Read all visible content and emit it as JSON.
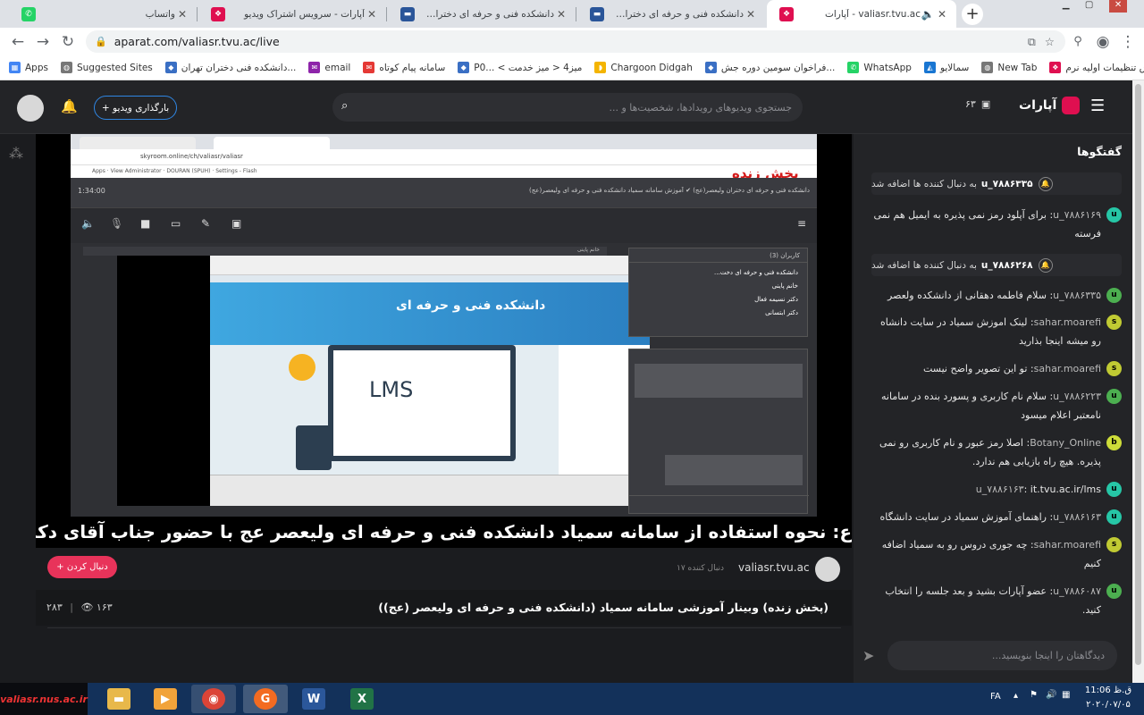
{
  "tabs": [
    {
      "title": "واتساب",
      "favicon": "whatsapp-icon",
      "color": "#25d366",
      "active": false
    },
    {
      "title": "آپارات - سرویس اشتراک ویدیو",
      "favicon": "aparat-icon",
      "color": "#df0f50",
      "active": false
    },
    {
      "title": "دانشکده فنی و حرفه ای دختران ولیعصر(ع)",
      "favicon": "skyroom-icon",
      "color": "#2a5599",
      "active": false
    },
    {
      "title": "دانشکده فنی و حرفه ای دختران ولیعصر(ع)",
      "favicon": "skyroom-icon",
      "color": "#2a5599",
      "active": false
    },
    {
      "title": "valiasr.tvu.ac - آپارات",
      "favicon": "aparat-icon",
      "color": "#df0f50",
      "active": true
    }
  ],
  "url": "aparat.com/valiasr.tvu.ac/live",
  "bookmarks": [
    {
      "label": "Apps",
      "icon": "apps-grid-icon",
      "color": "#4285f4"
    },
    {
      "label": "Suggested Sites",
      "icon": "globe-icon",
      "color": "#555"
    },
    {
      "label": "دانشکده فنی دختران تهران...",
      "icon": "site-icon",
      "color": "#3a6fc4"
    },
    {
      "label": "email",
      "icon": "email-icon",
      "color": "#8e24aa"
    },
    {
      "label": "سامانه پیام کوتاه",
      "icon": "sms-icon",
      "color": "#e53935"
    },
    {
      "label": "P0... < میز4 < میز خدمت",
      "icon": "site-icon",
      "color": "#3a6fc4"
    },
    {
      "label": "Chargoon Didgah",
      "icon": "chargoon-icon",
      "color": "#f4b400"
    },
    {
      "label": "فراخوان سومین دوره جش...",
      "icon": "site-icon",
      "color": "#3a6fc4"
    },
    {
      "label": "WhatsApp",
      "icon": "whatsapp-icon",
      "color": "#25d366"
    },
    {
      "label": "سمالایو",
      "icon": "samalive-icon",
      "color": "#1976d2"
    },
    {
      "label": "New Tab",
      "icon": "globe-icon",
      "color": "#555"
    },
    {
      "label": "آموزش تنظیمات اولیه نرم...",
      "icon": "aparat-icon",
      "color": "#df0f50"
    }
  ],
  "header": {
    "search_placeholder": "جستجوی ویدیوهای رویدادها، شخصیت‌ها و ...",
    "upload_label": "+ بارگذاری ویدیو",
    "count": "۶۳",
    "logo": "آپارات"
  },
  "player": {
    "live_label": "پخش زنده",
    "inner_url": "skyroom.online/ch/valiasr/valiasr",
    "session_title": "دانشکده فنی و حرفه ای دختران ولیعصر(عج) ✔ آموزش سامانه سمیاد دانشکده فنی و حرفه ای ولیعصر(عج)",
    "timer": "1:34:00",
    "share_title": "خانم پاینی",
    "users_title": "کاربران (3)",
    "users": [
      "دانشکده فنی و حرفه ای دخت...",
      "خانم پاینی",
      "دکتر نسیمه فعال",
      "دکتر ابتسانی"
    ],
    "lms_text": "LMS",
    "college_text": "دانشکده فنی و حرفه ای",
    "marquee": "ع: نحوه استفاده از سامانه سمیاد      دانشکده فنی و حرفه ای ولیعصر عج      با حضور جناب آقای دکتر"
  },
  "channel": {
    "name": "valiasr.tvu.ac",
    "followers": "۱۷ دنبال کننده",
    "follow_label": "+ دنبال کردن"
  },
  "video": {
    "title": "(پخش زنده) وبینار آموزشی سامانه سمیاد (دانشکده فنی و حرفه ای ولیعصر (عج))",
    "views": "۱۶۳",
    "likes": "۲۸۳"
  },
  "chat": {
    "heading": "گفتگوها",
    "input_placeholder": "دیدگاهتان را اینجا بنویسید...",
    "messages": [
      {
        "type": "join",
        "user": "u_۷۸۸۶۳۳۵",
        "text": "به دنبال کننده ها اضافه شد"
      },
      {
        "type": "msg",
        "user": "u_۷۸۸۶۱۶۹",
        "avatar": "u",
        "color": "#26c6a6",
        "text": "برای آپلود رمز نمی پذیره به ایمیل هم نمی فرسته"
      },
      {
        "type": "join",
        "user": "u_۷۸۸۶۲۶۸",
        "text": "به دنبال کننده ها اضافه شد"
      },
      {
        "type": "msg",
        "user": "u_۷۸۸۶۳۳۵",
        "avatar": "u",
        "color": "#4caf50",
        "text": "سلام فاطمه دهقانی از دانشکده ولعصر"
      },
      {
        "type": "msg",
        "user": "sahar.moarefi",
        "avatar": "s",
        "color": "#c0ca33",
        "text": "لینک اموزش سمیاد در سایت دانشاه رو میشه اینجا بذارید"
      },
      {
        "type": "msg",
        "user": "sahar.moarefi",
        "avatar": "s",
        "color": "#c0ca33",
        "text": "تو این تصویر واضح نیست"
      },
      {
        "type": "msg",
        "user": "u_۷۸۸۶۲۲۳",
        "avatar": "u",
        "color": "#4caf50",
        "text": "سلام نام کاربری و پسورد بنده در سامانه نامعتبر اعلام میسود"
      },
      {
        "type": "msg",
        "user": "Botany_Online",
        "avatar": "b",
        "color": "#cddc39",
        "text": "اصلا رمز عبور و نام کاربری رو نمی پذیره. هیچ راه بازیابی هم ندارد."
      },
      {
        "type": "msg",
        "user": "u_۷۸۸۶۱۶۳",
        "avatar": "u",
        "color": "#26c6a6",
        "text": "it.tvu.ac.ir/lms"
      },
      {
        "type": "msg",
        "user": "u_۷۸۸۶۱۶۳",
        "avatar": "u",
        "color": "#26c6a6",
        "text": "راهنمای آموزش سمیاد در سایت دانشگاه"
      },
      {
        "type": "msg",
        "user": "sahar.moarefi",
        "avatar": "s",
        "color": "#c0ca33",
        "text": "چه جوری دروس رو به سمیاد اضافه کنیم"
      },
      {
        "type": "msg",
        "user": "u_۷۸۸۶۰۸۷",
        "avatar": "u",
        "color": "#4caf50",
        "text": "عضو آپارات بشید و بعد جلسه را انتخاب کنید."
      }
    ]
  },
  "taskbar": {
    "start_label": "valiasr.nus.ac.ir",
    "lang": "FA",
    "time": "ق.ظ 11:06",
    "date": "۲۰۲۰/۰۷/۰۵"
  }
}
